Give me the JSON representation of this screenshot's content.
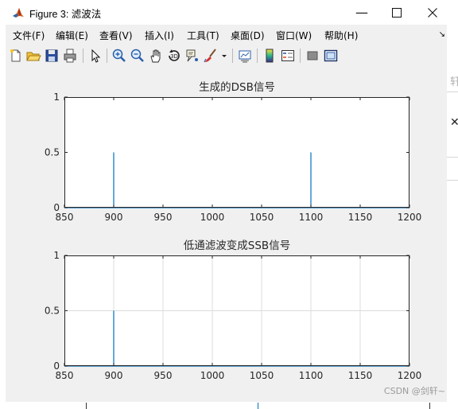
{
  "window": {
    "title": "Figure 3: 滤波法"
  },
  "menu": [
    {
      "label": "文件(F)"
    },
    {
      "label": "编辑(E)"
    },
    {
      "label": "查看(V)"
    },
    {
      "label": "插入(I)"
    },
    {
      "label": "工具(T)"
    },
    {
      "label": "桌面(D)"
    },
    {
      "label": "窗口(W)"
    },
    {
      "label": "帮助(H)"
    }
  ],
  "toolbar": [
    "new-figure-icon",
    "open-file-icon",
    "save-icon",
    "print-icon",
    "pointer-icon",
    "zoom-in-icon",
    "zoom-out-icon",
    "pan-icon",
    "rotate-3d-icon",
    "data-cursor-icon",
    "brush-icon",
    "link-plot-icon",
    "colorbar-icon",
    "legend-icon",
    "hide-plot-tools-icon",
    "show-plot-tools-icon"
  ],
  "background": {
    "glyph": "轩"
  },
  "watermark": "CSDN @剑轩~",
  "colors": {
    "line": "#0072BD",
    "grid": "#dcdcdc",
    "axes_bg": "#ffffff",
    "figure_bg": "#f0f0f0"
  },
  "chart_data": [
    {
      "type": "line",
      "title": "生成的DSB信号",
      "xlim": [
        850,
        1200
      ],
      "ylim": [
        0,
        1
      ],
      "xticks": [
        850,
        900,
        950,
        1000,
        1050,
        1100,
        1150,
        1200
      ],
      "yticks": [
        0,
        0.5,
        1
      ],
      "xtick_labels": [
        "850",
        "900",
        "950",
        "1000",
        "1050",
        "1100",
        "1150",
        "1200"
      ],
      "ytick_labels": [
        "0",
        "0.5",
        "1"
      ],
      "grid": false,
      "series": [
        {
          "x": [
            850,
            900,
            900,
            900,
            1100,
            1100,
            1100,
            1200
          ],
          "y": [
            0,
            0,
            0.5,
            0,
            0,
            0.5,
            0,
            0
          ]
        }
      ]
    },
    {
      "type": "line",
      "title": "低通滤波变成SSB信号",
      "xlim": [
        850,
        1200
      ],
      "ylim": [
        0,
        1
      ],
      "xticks": [
        850,
        900,
        950,
        1000,
        1050,
        1100,
        1150,
        1200
      ],
      "yticks": [
        0,
        0.5,
        1
      ],
      "xtick_labels": [
        "850",
        "900",
        "950",
        "1000",
        "1050",
        "1100",
        "1150",
        "1200"
      ],
      "ytick_labels": [
        "0",
        "0.5",
        "1"
      ],
      "grid": true,
      "series": [
        {
          "x": [
            850,
            900,
            900,
            900,
            1200
          ],
          "y": [
            0,
            0,
            0.5,
            0,
            0
          ]
        }
      ]
    }
  ]
}
